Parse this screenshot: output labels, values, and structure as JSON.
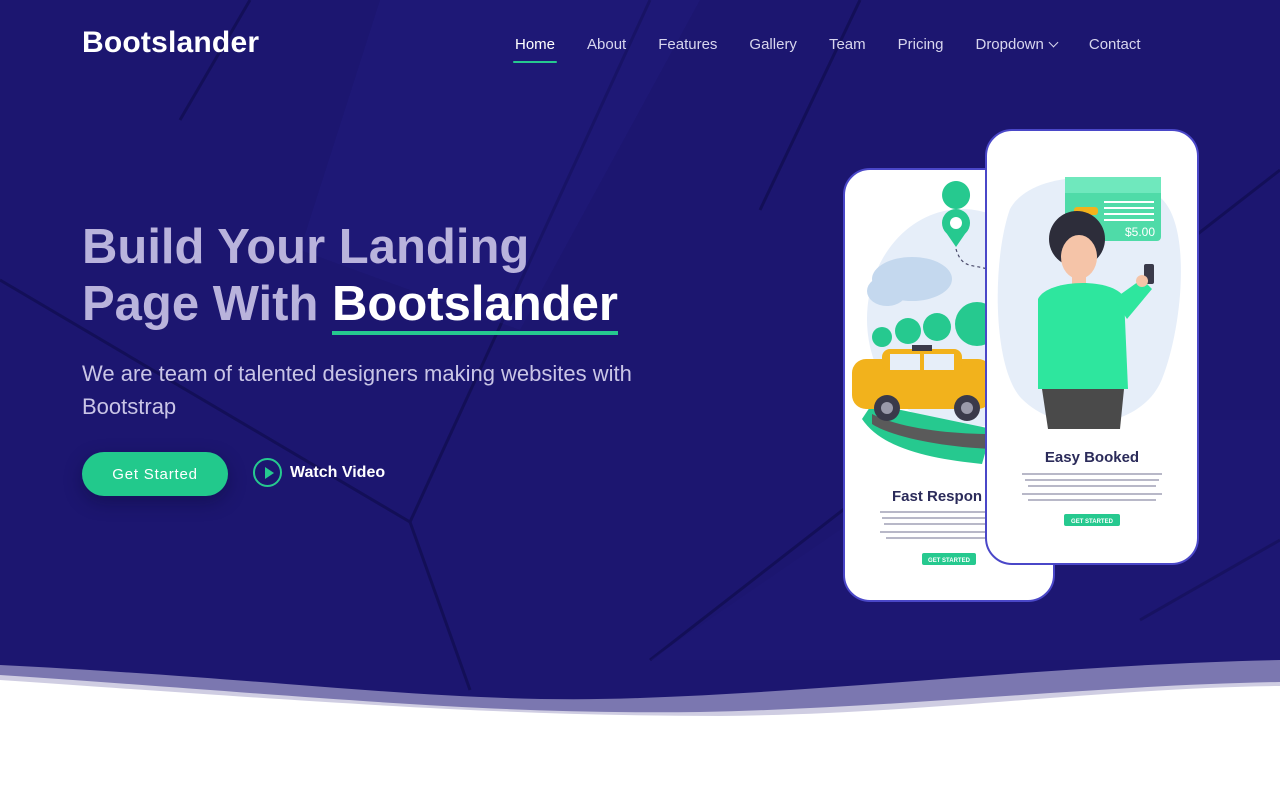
{
  "brand": {
    "name": "Bootslander"
  },
  "nav": {
    "items": [
      {
        "label": "Home",
        "active": true
      },
      {
        "label": "About"
      },
      {
        "label": "Features"
      },
      {
        "label": "Gallery"
      },
      {
        "label": "Team"
      },
      {
        "label": "Pricing"
      },
      {
        "label": "Dropdown"
      },
      {
        "label": "Contact"
      }
    ]
  },
  "hero": {
    "title_line1": "Build Your Landing",
    "title_line2_prefix": "Page With ",
    "title_highlight": "Bootslander",
    "subtitle": "We are team of talented designers making websites with Bootstrap",
    "cta_label": "Get Started",
    "video_label": "Watch Video"
  },
  "illustration": {
    "left_phone_title": "Fast Respon",
    "right_phone_title": "Easy Booked",
    "price": "$5.00",
    "button_label": "GET STARTED"
  },
  "colors": {
    "hero_bg": "#1c1670",
    "accent": "#26c98f",
    "headline_muted": "#b9b3dc"
  },
  "icons": {
    "dropdown": "chevron-down-icon",
    "video": "play-icon"
  }
}
